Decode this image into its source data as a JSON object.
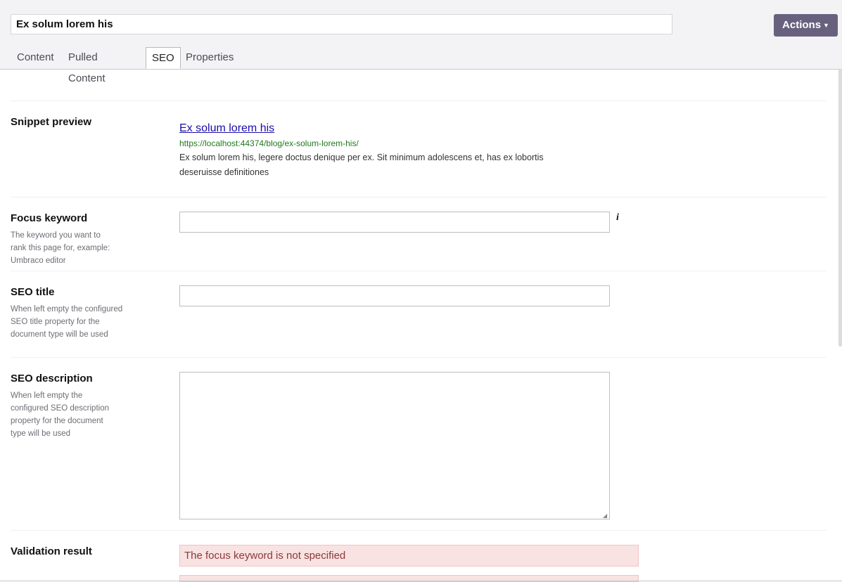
{
  "header": {
    "node_name": "Ex solum lorem his",
    "actions_label": "Actions"
  },
  "tabs": [
    {
      "label": "Content"
    },
    {
      "label": "Pulled Content"
    },
    {
      "label": "SEO"
    },
    {
      "label": "Properties"
    }
  ],
  "active_tab": "SEO",
  "snippet": {
    "label": "Snippet preview",
    "title": "Ex solum lorem his",
    "url": "https://localhost:44374/blog/ex-solum-lorem-his/",
    "description": "Ex solum lorem his, legere doctus denique per ex. Sit minimum adolescens et, has ex lobortis deseruisse definitiones"
  },
  "focus_keyword": {
    "label": "Focus keyword",
    "description": "The keyword you want to rank this page for, example: Umbraco editor",
    "value": ""
  },
  "seo_title": {
    "label": "SEO title",
    "description": "When left empty the configured SEO title property for the document type will be used",
    "value": ""
  },
  "seo_description": {
    "label": "SEO description",
    "description": "When left empty the configured SEO description property for the document type will be used",
    "value": ""
  },
  "validation": {
    "label": "Validation result",
    "messages": [
      "The focus keyword is not specified"
    ]
  },
  "colors": {
    "actions_bg": "#68617e",
    "link": "#1a0dab",
    "url_green": "#1e7a1e",
    "alert_bg": "#f9e2e2"
  }
}
